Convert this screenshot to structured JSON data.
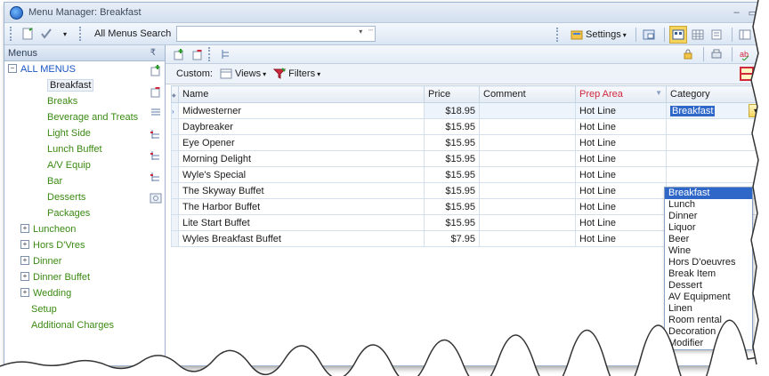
{
  "window": {
    "title": "Menu Manager: Breakfast",
    "minimize": "–",
    "restore": "▭"
  },
  "toolbar": {
    "search_label": "All Menus Search",
    "search_value": "",
    "settings_label": "Settings"
  },
  "left_panel": {
    "header": "Menus",
    "root": "ALL MENUS",
    "breakfast_children": [
      "Breakfast",
      "Breaks",
      "Beverage and Treats",
      "Light Side",
      "Lunch Buffet",
      "A/V Equip",
      "Bar",
      "Desserts",
      "Packages"
    ],
    "groups": [
      "Luncheon",
      "Hors D'Vres",
      "Dinner",
      "Dinner Buffet",
      "Wedding"
    ],
    "trailing": [
      "Setup",
      "Additional Charges"
    ],
    "selected": "Breakfast"
  },
  "view_bar": {
    "custom_label": "Custom:",
    "views_label": "Views",
    "filters_label": "Filters"
  },
  "grid": {
    "columns": {
      "name": "Name",
      "price": "Price",
      "comment": "Comment",
      "prep_area": "Prep Area",
      "category": "Category"
    },
    "rows": [
      {
        "name": "Midwesterner",
        "price": "$18.95",
        "comment": "",
        "prep": "Hot Line",
        "category": "Breakfast"
      },
      {
        "name": "Daybreaker",
        "price": "$15.95",
        "comment": "",
        "prep": "Hot Line",
        "category": ""
      },
      {
        "name": "Eye Opener",
        "price": "$15.95",
        "comment": "",
        "prep": "Hot Line",
        "category": ""
      },
      {
        "name": "Morning Delight",
        "price": "$15.95",
        "comment": "",
        "prep": "Hot Line",
        "category": ""
      },
      {
        "name": "Wyle's Special",
        "price": "$15.95",
        "comment": "",
        "prep": "Hot Line",
        "category": ""
      },
      {
        "name": "The Skyway Buffet",
        "price": "$15.95",
        "comment": "",
        "prep": "Hot Line",
        "category": ""
      },
      {
        "name": "The Harbor Buffet",
        "price": "$15.95",
        "comment": "",
        "prep": "Hot Line",
        "category": ""
      },
      {
        "name": "Lite Start Buffet",
        "price": "$15.95",
        "comment": "",
        "prep": "Hot Line",
        "category": ""
      },
      {
        "name": "Wyles Breakfast Buffet",
        "price": "$7.95",
        "comment": "",
        "prep": "Hot Line",
        "category": ""
      }
    ]
  },
  "category_dropdown": {
    "selected": "Breakfast",
    "options": [
      "Breakfast",
      "Lunch",
      "Dinner",
      "Liquor",
      "Beer",
      "Wine",
      "Hors D'oeuvres",
      "Break Item",
      "Dessert",
      "AV Equipment",
      "Linen",
      "Room rental",
      "Decoration",
      "Modifier"
    ]
  },
  "colors": {
    "accent": "#2f67c9",
    "menu_green": "#3a8a12",
    "prep_header_red": "#d2283c",
    "root_blue": "#1a55c4"
  }
}
